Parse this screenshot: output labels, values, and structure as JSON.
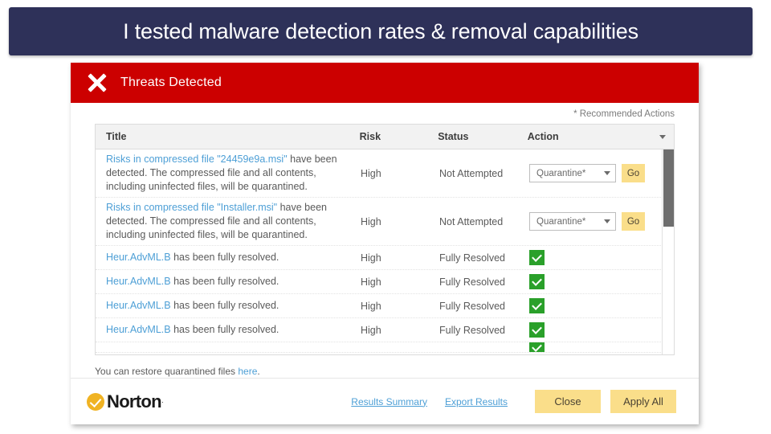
{
  "banner": {
    "text": "I tested malware detection rates & removal capabilities",
    "background": "#2e3159"
  },
  "dialog": {
    "header": {
      "title": "Threats Detected",
      "icon": "x-icon",
      "background": "#cc0000"
    },
    "recommended_note": "* Recommended Actions",
    "table": {
      "columns": [
        "Title",
        "Risk",
        "Status",
        "Action"
      ],
      "sort_icon": "chevron-down-icon",
      "rows": [
        {
          "title_link": "Risks in compressed file \"24459e9a.msi\"",
          "title_rest": " have been detected. The compressed file and all contents, including uninfected files, will be quarantined.",
          "risk": "High",
          "status": "Not Attempted",
          "action_type": "select",
          "action_value": "Quarantine*",
          "action_button": "Go"
        },
        {
          "title_link": "Risks in compressed file \"Installer.msi\"",
          "title_rest": " have been detected. The compressed file and all contents, including uninfected files, will be quarantined.",
          "risk": "High",
          "status": "Not Attempted",
          "action_type": "select",
          "action_value": "Quarantine*",
          "action_button": "Go"
        },
        {
          "title_link": "Heur.AdvML.B",
          "title_rest": " has been fully resolved.",
          "risk": "High",
          "status": "Fully Resolved",
          "action_type": "check"
        },
        {
          "title_link": "Heur.AdvML.B",
          "title_rest": " has been fully resolved.",
          "risk": "High",
          "status": "Fully Resolved",
          "action_type": "check"
        },
        {
          "title_link": "Heur.AdvML.B",
          "title_rest": " has been fully resolved.",
          "risk": "High",
          "status": "Fully Resolved",
          "action_type": "check"
        },
        {
          "title_link": "Heur.AdvML.B",
          "title_rest": " has been fully resolved.",
          "risk": "High",
          "status": "Fully Resolved",
          "action_type": "check"
        }
      ]
    },
    "restore": {
      "prefix": "You can restore quarantined files ",
      "link": "here",
      "suffix": "."
    },
    "footer": {
      "logo_text": "Norton",
      "logo_tm": "·",
      "links": [
        "Results Summary",
        "Export Results"
      ],
      "buttons": [
        "Close",
        "Apply All"
      ],
      "button_color": "#fade8a"
    }
  }
}
